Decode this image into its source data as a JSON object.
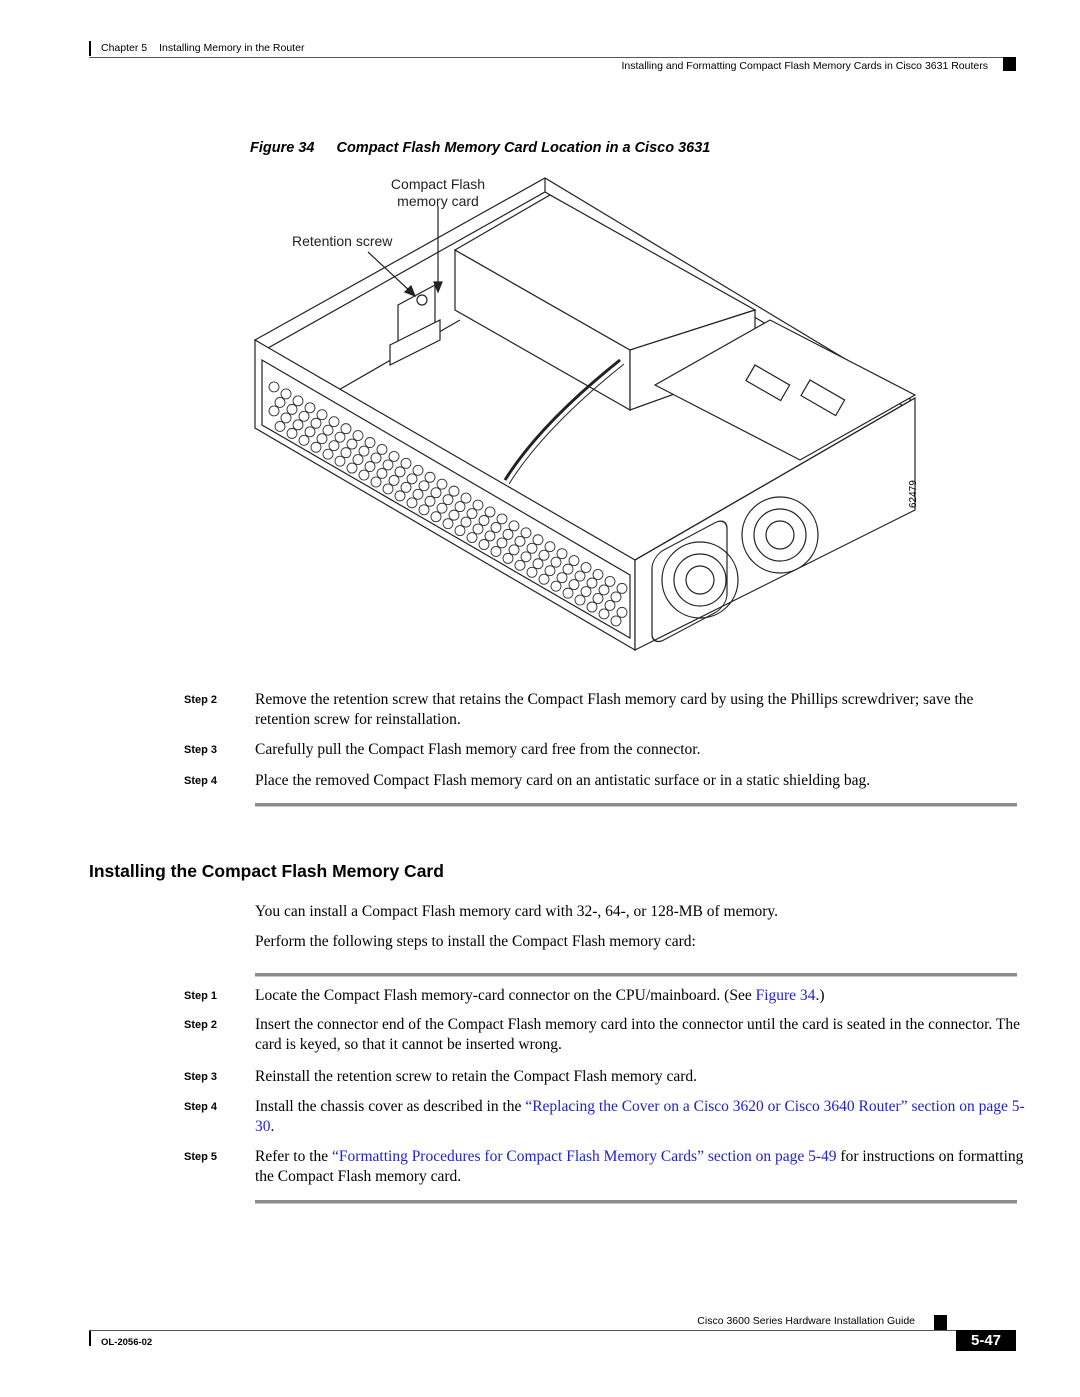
{
  "header": {
    "chapter_label": "Chapter 5",
    "chapter_title": "Installing Memory in the Router",
    "section_title": "Installing and Formatting Compact Flash Memory Cards in Cisco 3631 Routers"
  },
  "figure": {
    "number": "Figure 34",
    "title": "Compact Flash Memory Card Location in a Cisco 3631",
    "callouts": {
      "memory_card_line1": "Compact Flash",
      "memory_card_line2": "memory card",
      "retention_screw": "Retention screw"
    },
    "art_id": "62479"
  },
  "removal_steps": [
    {
      "label": "Step 2",
      "text": "Remove the retention screw that retains the Compact Flash memory card by using the Phillips screwdriver; save the retention screw for reinstallation."
    },
    {
      "label": "Step 3",
      "text": "Carefully pull the Compact Flash memory card free from the connector."
    },
    {
      "label": "Step 4",
      "text": "Place the removed Compact Flash memory card on an antistatic surface or in a static shielding bag."
    }
  ],
  "install_section": {
    "heading": "Installing the Compact Flash Memory Card",
    "intro_1": "You can install a Compact Flash memory card with 32-, 64-, or 128-MB of memory.",
    "intro_2": "Perform the following steps to install the Compact Flash memory card:",
    "steps": [
      {
        "label": "Step 1",
        "text_before": "Locate the Compact Flash memory-card connector on the CPU/mainboard. (See ",
        "link": "Figure 34",
        "text_after": ".)"
      },
      {
        "label": "Step 2",
        "text": "Insert the connector end of the Compact Flash memory card into the connector until the card is seated in the connector. The card is keyed, so that it cannot be inserted wrong."
      },
      {
        "label": "Step 3",
        "text": "Reinstall the retention screw to retain the Compact Flash memory card."
      },
      {
        "label": "Step 4",
        "text_before": "Install the chassis cover as described in the ",
        "link": "“Replacing the Cover on a Cisco 3620 or Cisco 3640 Router” section on page 5-30",
        "text_after": "."
      },
      {
        "label": "Step 5",
        "text_before": "Refer to the ",
        "link": "“Formatting Procedures for Compact Flash Memory Cards” section on page 5-49",
        "text_after": " for instructions on formatting the Compact Flash memory card."
      }
    ]
  },
  "footer": {
    "guide_title": "Cisco 3600 Series Hardware Installation Guide",
    "doc_number": "OL-2056-02",
    "page_number": "5-47"
  },
  "colors": {
    "link": "#1f1fd6",
    "rule": "#8c8c8c"
  }
}
